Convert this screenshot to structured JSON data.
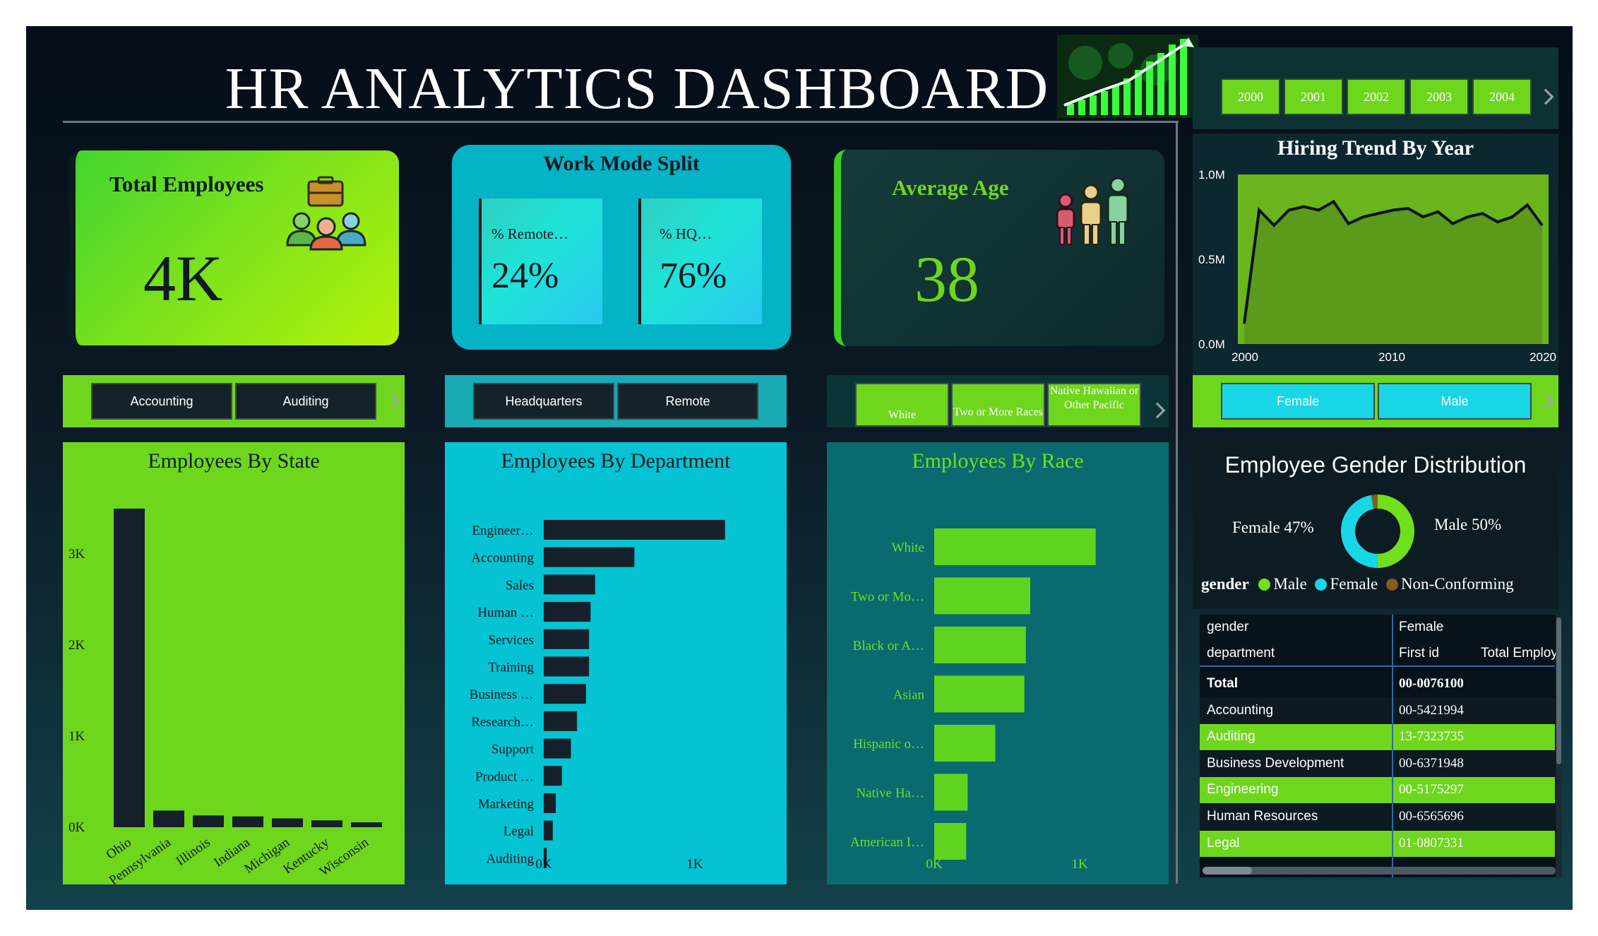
{
  "header": {
    "title": "HR ANALYTICS DASHBOARD"
  },
  "kpis": {
    "total_employees": {
      "label": "Total Employees",
      "value": "4K"
    },
    "work_mode": {
      "title": "Work Mode Split",
      "remote_label": "% Remote…",
      "remote_value": "24%",
      "hq_label": "% HQ…",
      "hq_value": "76%"
    },
    "average_age": {
      "label": "Average Age",
      "value": "38"
    }
  },
  "slicers": {
    "department": [
      "Accounting",
      "Auditing"
    ],
    "location": [
      "Headquarters",
      "Remote"
    ],
    "race": [
      "White",
      "Two or More Races",
      "Native Hawaiian or Other Pacific"
    ],
    "gender": [
      "Female",
      "Male"
    ],
    "years": [
      "2000",
      "2001",
      "2002",
      "2003",
      "2004"
    ]
  },
  "hiring_trend": {
    "title": "Hiring Trend By Year"
  },
  "employees_by_state": {
    "title": "Employees By State"
  },
  "employees_by_department": {
    "title": "Employees By Department"
  },
  "employees_by_race": {
    "title": "Employees By Race"
  },
  "gender_distribution": {
    "title": "Employee Gender Distribution",
    "female_label": "Female 47%",
    "male_label": "Male 50%",
    "legend_title": "gender",
    "legend": [
      {
        "name": "Male",
        "color": "#6fe01c"
      },
      {
        "name": "Female",
        "color": "#19d6e6"
      },
      {
        "name": "Non-Conforming",
        "color": "#8a5a1c"
      }
    ]
  },
  "table": {
    "header_row1": [
      "gender",
      "Female"
    ],
    "header_row2": [
      "department",
      "First id",
      "Total Employ"
    ],
    "rows": [
      {
        "name": "Total",
        "id": "00-0076100"
      },
      {
        "name": "Accounting",
        "id": "00-5421994"
      },
      {
        "name": "Auditing",
        "id": "13-7323735"
      },
      {
        "name": "Business Development",
        "id": "00-6371948"
      },
      {
        "name": "Engineering",
        "id": "00-5175297"
      },
      {
        "name": "Human Resources",
        "id": "00-6565696"
      },
      {
        "name": "Legal",
        "id": "01-0807331"
      }
    ]
  },
  "chart_data": [
    {
      "type": "area",
      "title": "Hiring Trend By Year",
      "x": [
        2000,
        2001,
        2002,
        2003,
        2004,
        2005,
        2006,
        2007,
        2008,
        2009,
        2010,
        2011,
        2012,
        2013,
        2014,
        2015,
        2016,
        2017,
        2018,
        2019,
        2020
      ],
      "values": [
        0.12,
        0.79,
        0.7,
        0.79,
        0.81,
        0.79,
        0.84,
        0.71,
        0.75,
        0.77,
        0.79,
        0.8,
        0.75,
        0.78,
        0.71,
        0.75,
        0.77,
        0.72,
        0.75,
        0.82,
        0.7
      ],
      "xlabel": "",
      "ylabel": "",
      "xticks": [
        "2000",
        "2010",
        "2020"
      ],
      "yticks": [
        "0.0M",
        "0.5M",
        "1.0M"
      ],
      "ylim": [
        0,
        1.0
      ],
      "color": "#6ab51e"
    },
    {
      "type": "bar",
      "title": "Employees By State",
      "categories": [
        "Ohio",
        "Pennsylvania",
        "Illinois",
        "Indiana",
        "Michigan",
        "Kentucky",
        "Wisconsin"
      ],
      "values": [
        3250,
        170,
        120,
        110,
        90,
        70,
        50
      ],
      "yticks": [
        "0K",
        "1K",
        "2K",
        "3K"
      ],
      "ylim": [
        0,
        3250
      ],
      "color": "#16202a"
    },
    {
      "type": "bar",
      "orientation": "horizontal",
      "title": "Employees By Department",
      "categories": [
        "Engineer…",
        "Accounting",
        "Sales",
        "Human …",
        "Services",
        "Training",
        "Business …",
        "Research…",
        "Support",
        "Product …",
        "Marketing",
        "Legal",
        "Auditing"
      ],
      "values": [
        1200,
        600,
        340,
        310,
        300,
        300,
        280,
        220,
        180,
        120,
        80,
        60,
        20
      ],
      "xticks": [
        "0K",
        "1K"
      ],
      "xlim": [
        0,
        1000
      ],
      "color": "#16202a"
    },
    {
      "type": "bar",
      "orientation": "horizontal",
      "title": "Employees By Race",
      "categories": [
        "White",
        "Two or Mo…",
        "Black or A…",
        "Asian",
        "Hispanic o…",
        "Native Ha…",
        "American I…"
      ],
      "values": [
        1110,
        660,
        630,
        620,
        420,
        230,
        220
      ],
      "xticks": [
        "0K",
        "1K"
      ],
      "xlim": [
        0,
        1000
      ],
      "color": "#5fd41e"
    },
    {
      "type": "pie",
      "title": "Employee Gender Distribution",
      "categories": [
        "Male",
        "Female",
        "Non-Conforming"
      ],
      "values": [
        50,
        47,
        3
      ],
      "colors": [
        "#6fe01c",
        "#19d6e6",
        "#8a5a1c"
      ]
    }
  ]
}
